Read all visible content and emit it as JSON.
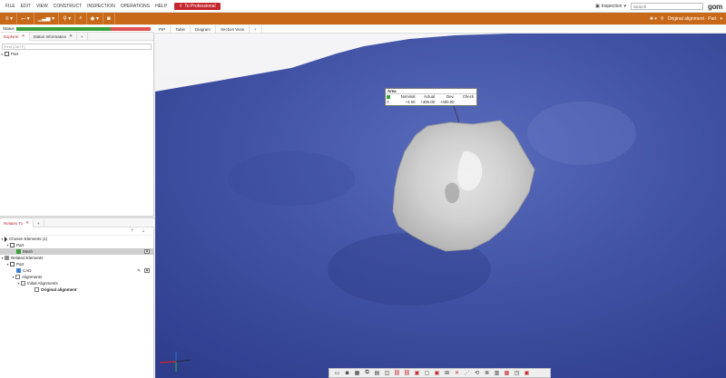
{
  "menu": {
    "items": [
      "FILE",
      "EDIT",
      "VIEW",
      "CONSTRUCT",
      "INSPECTION",
      "OPERATIONS",
      "HELP"
    ],
    "pro_label": "To Professional",
    "inspection_label": "Inspection",
    "search_placeholder": "Search",
    "logo": "gom"
  },
  "toolbar": {
    "alignment_label": "Original alignment · Part"
  },
  "status": {
    "label": "Status",
    "progress_fraction": 0.7,
    "fill_color": "#3aa13a",
    "remain_color": "#e05050"
  },
  "view_tabs": [
    "PIP",
    "Table",
    "Diagram",
    "Section View",
    "+"
  ],
  "explorer": {
    "tabs": [
      "Explorer",
      "Status Information",
      "+"
    ],
    "find_placeholder": "Find (Ctrl+F)",
    "tree": [
      {
        "label": "Part"
      }
    ]
  },
  "relates_to": {
    "tab": "Relates To",
    "chosen_header": "Chosen Elements (1)",
    "chosen_part": "Part",
    "chosen_mesh": "Mesh",
    "related_header": "Related Elements",
    "related_part": "Part",
    "cad": "CAD",
    "alignments": "Alignments",
    "initial_alignments": "Initial Alignments",
    "original_alignment": "Original alignment"
  },
  "label": {
    "title": "Area",
    "headers": [
      "Nominal",
      "Actual",
      "Dev.",
      "Check"
    ],
    "row_key": "A",
    "nominal": "+4.00",
    "actual": "+400.00",
    "dev": "+400.00"
  },
  "colors": {
    "accent_orange": "#c8691a",
    "brand_red": "#c4262e",
    "surface_blue": "#3f53a5"
  }
}
